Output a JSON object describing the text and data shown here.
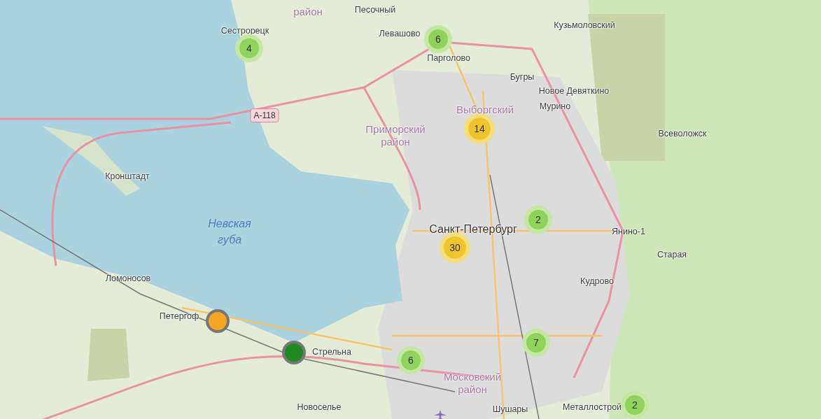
{
  "map": {
    "labels": [
      {
        "text": "район",
        "kind": "district"
      },
      {
        "text": "Песочный",
        "kind": "place"
      },
      {
        "text": "Левашово",
        "kind": "place"
      },
      {
        "text": "Парголово",
        "kind": "place"
      },
      {
        "text": "Кузьмоловский",
        "kind": "place"
      },
      {
        "text": "Бугры",
        "kind": "place"
      },
      {
        "text": "Новое Девяткино",
        "kind": "place"
      },
      {
        "text": "Мурино",
        "kind": "place"
      },
      {
        "text": "Сестрорецк",
        "kind": "place"
      },
      {
        "text": "А-118",
        "kind": "road"
      },
      {
        "text": "Приморский",
        "kind": "district"
      },
      {
        "text": "район",
        "kind": "district"
      },
      {
        "text": "Выборгский",
        "kind": "district"
      },
      {
        "text": "Всеволожск",
        "kind": "place"
      },
      {
        "text": "Кронштадт",
        "kind": "place"
      },
      {
        "text": "Невская",
        "kind": "water"
      },
      {
        "text": "губа",
        "kind": "water"
      },
      {
        "text": "Санкт-Петербург",
        "kind": "city"
      },
      {
        "text": "Янино-1",
        "kind": "place"
      },
      {
        "text": "Старая",
        "kind": "place"
      },
      {
        "text": "Ломоносов",
        "kind": "place"
      },
      {
        "text": "Кудрово",
        "kind": "place"
      },
      {
        "text": "Петергоф",
        "kind": "place"
      },
      {
        "text": "Стрельна",
        "kind": "place"
      },
      {
        "text": "Московский",
        "kind": "district"
      },
      {
        "text": "район",
        "kind": "district"
      },
      {
        "text": "Новоселье",
        "kind": "place"
      },
      {
        "text": "Шушары",
        "kind": "place"
      },
      {
        "text": "Металлострой",
        "kind": "place"
      }
    ],
    "markers": [
      {
        "kind": "cluster",
        "count": "4",
        "color": "#8fd35c"
      },
      {
        "kind": "cluster",
        "count": "6",
        "color": "#8fd35c"
      },
      {
        "kind": "cluster",
        "count": "14",
        "color": "#f0c52c"
      },
      {
        "kind": "cluster",
        "count": "2",
        "color": "#8fd35c"
      },
      {
        "kind": "cluster",
        "count": "30",
        "color": "#f0c52c"
      },
      {
        "kind": "cluster",
        "count": "7",
        "color": "#8fd35c"
      },
      {
        "kind": "cluster",
        "count": "6",
        "color": "#8fd35c"
      },
      {
        "kind": "cluster",
        "count": "2",
        "color": "#8fd35c"
      },
      {
        "kind": "point",
        "color": "#f5a623"
      },
      {
        "kind": "point",
        "color": "#1f8a1f"
      }
    ]
  }
}
